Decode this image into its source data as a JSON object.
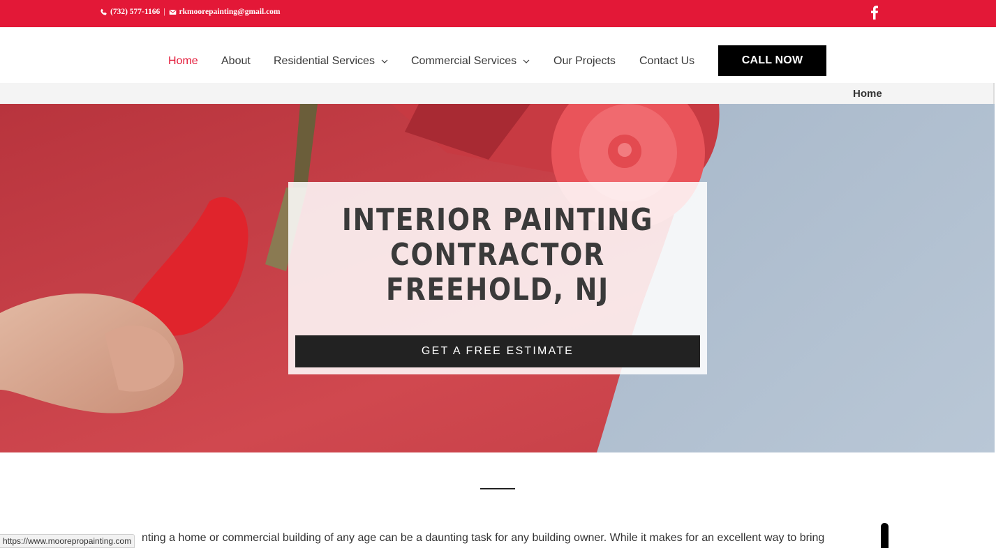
{
  "topbar": {
    "phone": "(732) 577-1166",
    "separator": "|",
    "email": "rkmoorepainting@gmail.com",
    "social_icon": "facebook-icon",
    "bg_color": "#e31837"
  },
  "nav": {
    "items": [
      {
        "label": "Home",
        "active": true
      },
      {
        "label": "About"
      },
      {
        "label": "Residential Services",
        "dropdown": true
      },
      {
        "label": "Commercial Services",
        "dropdown": true
      },
      {
        "label": "Our Projects"
      },
      {
        "label": "Contact Us"
      }
    ],
    "cta": "CALL NOW"
  },
  "breadcrumb": {
    "current": "Home"
  },
  "hero": {
    "title_lines": [
      "INTERIOR PAINTING",
      "CONTRACTOR",
      "FREEHOLD, NJ"
    ],
    "button": "GET A FREE ESTIMATE"
  },
  "content": {
    "paragraph": "nting a home or commercial building of any age can be a daunting task for any building owner. While it makes for an excellent way to bring"
  },
  "status_bar": {
    "url": "https://www.moorepropainting.com"
  },
  "colors": {
    "accent": "#e31837",
    "dark": "#222222",
    "text": "#3a3a3a"
  }
}
